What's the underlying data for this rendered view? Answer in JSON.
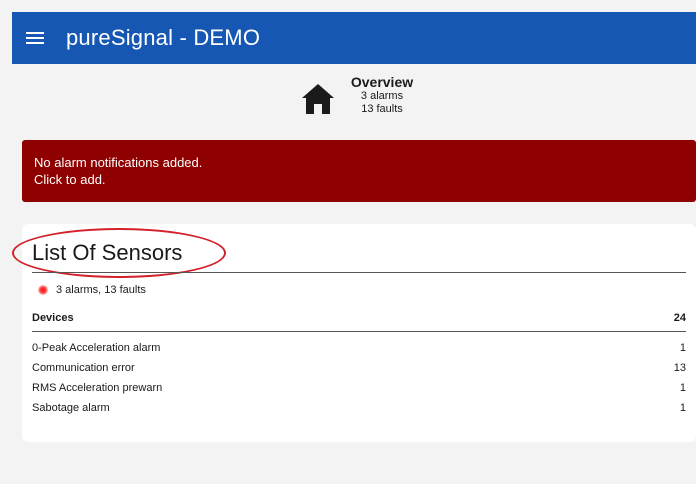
{
  "app": {
    "title": "pureSignal - DEMO",
    "menu_icon": "hamburger-icon",
    "accent": "#1657b3"
  },
  "overview": {
    "title": "Overview",
    "alarms": "3 alarms",
    "faults": "13 faults",
    "icon": "home-icon"
  },
  "banner": {
    "line1": "No alarm notifications added.",
    "line2": "Click to add.",
    "color": "#8f0000"
  },
  "sensors": {
    "title": "List Of Sensors",
    "status": "3 alarms, 13 faults",
    "status_color": "#ff2020",
    "table": {
      "headers": [
        "Devices",
        "24"
      ],
      "rows": [
        {
          "name": "0-Peak Acceleration alarm",
          "count": "1"
        },
        {
          "name": "Communication error",
          "count": "13"
        },
        {
          "name": "RMS Acceleration prewarn",
          "count": "1"
        },
        {
          "name": "Sabotage alarm",
          "count": "1"
        }
      ]
    }
  }
}
